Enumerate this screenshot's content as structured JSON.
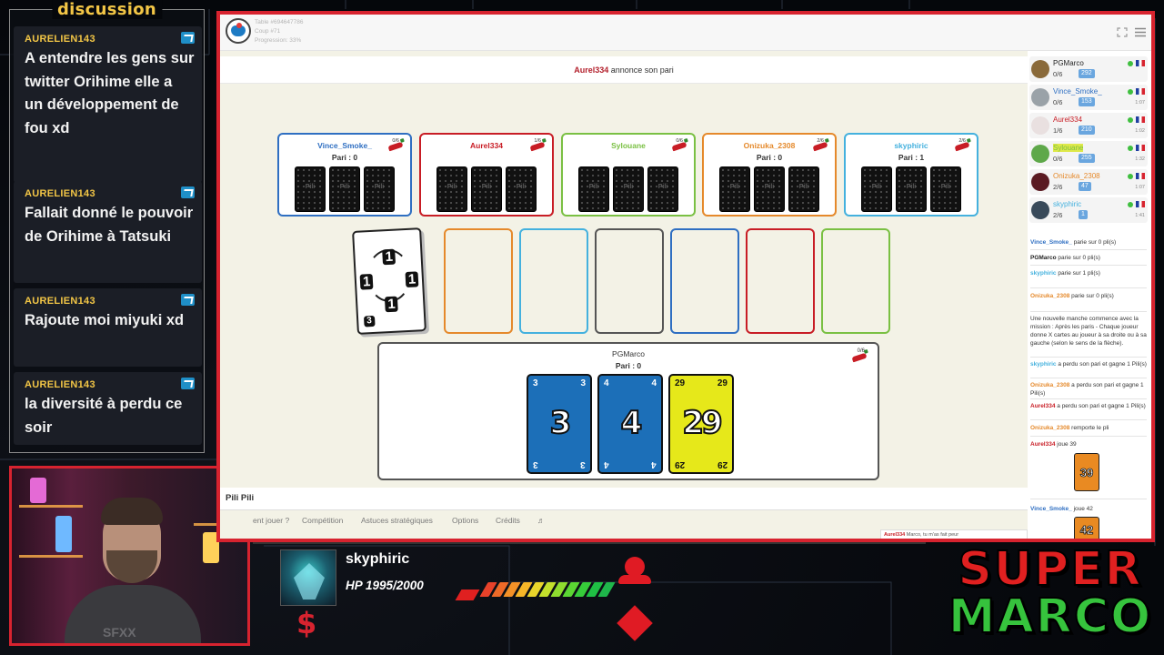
{
  "colors": {
    "accent_red": "#d7232f",
    "chat_user": "#f3c646",
    "blue_card": "#1c6fb8",
    "yellow_card": "#e6e81a"
  },
  "chat": {
    "title": "discussion",
    "messages": [
      {
        "user": "AURELIEN143",
        "text": "A entendre les gens sur twitter Orihime elle a un développement de fou xd"
      },
      {
        "user": "AURELIEN143",
        "text": "Fallait donné le pouvoir de Orihime à Tatsuki"
      },
      {
        "user": "AURELIEN143",
        "text": "Rajoute moi miyuki xd"
      },
      {
        "user": "AURELIEN143",
        "text": "la diversité à perdu ce soir"
      }
    ]
  },
  "webcam": {
    "shirt_text": "SFXX"
  },
  "browser": {
    "table_line1": "Table #694647786",
    "table_line2": "Coup #71",
    "table_line3": "Progression: 33%",
    "announce_player": "Aurel334",
    "announce_text": " annonce son pari"
  },
  "players": [
    {
      "name": "Vince_Smoke_",
      "bet": "Pari : 0",
      "score": "0/6",
      "color": "#2f6fc2"
    },
    {
      "name": "Aurel334",
      "bet": "",
      "score": "1/6",
      "color": "#c81d25"
    },
    {
      "name": "Sylouane",
      "bet": "",
      "score": "0/6",
      "color": "#7ac043"
    },
    {
      "name": "Onizuka_2308",
      "bet": "Pari : 0",
      "score": "2/6",
      "color": "#e5892b"
    },
    {
      "name": "skyphiric",
      "bet": "Pari : 1",
      "score": "2/6",
      "color": "#44b1de"
    }
  ],
  "deck": {
    "value": "1",
    "bottom": "3"
  },
  "slots": [
    "#e5892b",
    "#44b1de",
    "#555555",
    "#2f6fc2",
    "#c81d25",
    "#7ac043"
  ],
  "hand": {
    "name": "PGMarco",
    "bet": "Pari : 0",
    "score": "0/6",
    "cards": [
      {
        "value": "3",
        "color": "#1c6fb8"
      },
      {
        "value": "4",
        "color": "#1c6fb8"
      },
      {
        "value": "29",
        "color": "#e6e81a"
      }
    ]
  },
  "game_title": "Pili Pili",
  "menu": [
    "ent jouer ?",
    "Compétition",
    "Astuces stratégiques",
    "Options",
    "Crédits",
    "♬"
  ],
  "sidebar_players": [
    {
      "name": "PGMarco",
      "score": "0/6",
      "points": "292",
      "time": "",
      "color": "#222"
    },
    {
      "name": "Vince_Smoke_",
      "score": "0/6",
      "points": "153",
      "time": "1:07",
      "color": "#2f6fc2"
    },
    {
      "name": "Aurel334",
      "score": "1/6",
      "points": "210",
      "time": "1:02",
      "color": "#c81d25"
    },
    {
      "name": "Sylouane",
      "score": "0/6",
      "points": "255",
      "time": "1:32",
      "color": "#7ac043"
    },
    {
      "name": "Onizuka_2308",
      "score": "2/6",
      "points": "47",
      "time": "1:07",
      "color": "#e5892b"
    },
    {
      "name": "skyphiric",
      "score": "2/6",
      "points": "1",
      "time": "1:41",
      "color": "#44b1de"
    }
  ],
  "log": [
    {
      "who": "Vince_Smoke_",
      "text": " parie sur 0 pli(s)",
      "color": "#2f6fc2"
    },
    {
      "who": "PGMarco",
      "text": " parie sur 0 pli(s)",
      "color": "#222"
    },
    {
      "who": "skyphiric",
      "text": " parie sur 1 pli(s)",
      "color": "#44b1de"
    },
    {
      "who": "Onizuka_2308",
      "text": " parie sur 0 pli(s)",
      "color": "#e5892b"
    },
    {
      "who": "",
      "text": "Une nouvelle manche commence avec la mission : Après les paris - Chaque joueur donne X cartes au joueur à sa droite ou à sa gauche (selon le sens de la flèche).",
      "color": "#222"
    },
    {
      "who": "skyphiric",
      "text": " a perdu son pari et gagne 1 Pili(s)",
      "color": "#44b1de"
    },
    {
      "who": "Onizuka_2308",
      "text": " a perdu son pari et gagne 1 Pili(s)",
      "color": "#e5892b"
    },
    {
      "who": "Aurel334",
      "text": " a perdu son pari et gagne 1 Pili(s)",
      "color": "#c81d25"
    },
    {
      "who": "Onizuka_2308",
      "text": " remporte le pli",
      "color": "#e5892b"
    },
    {
      "who": "Aurel334",
      "text": " joue 39",
      "color": "#c81d25"
    },
    {
      "who": "Vince_Smoke_",
      "text": " joue 42",
      "color": "#2f6fc2"
    }
  ],
  "played_cards": [
    "39",
    "42"
  ],
  "chat_bubble": {
    "who": "Aurel334",
    "text": " Marco, tu m'as fait peur"
  },
  "hud": {
    "name": "skyphiric",
    "hp": "HP 1995/2000",
    "currency": "$"
  },
  "brand": {
    "line1": "SUPER",
    "line2": "MARCO"
  }
}
